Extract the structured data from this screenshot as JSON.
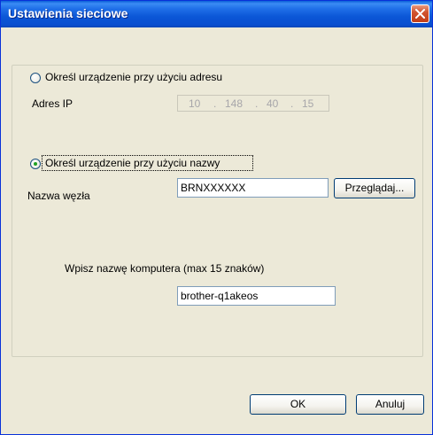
{
  "window": {
    "title": "Ustawienia sieciowe"
  },
  "by_address": {
    "radio_label": "Określ urządzenie przy użyciu adresu",
    "ip_label": "Adres IP",
    "ip": [
      "10",
      "148",
      "40",
      "15"
    ],
    "selected": false
  },
  "by_name": {
    "radio_label": "Określ urządzenie przy użyciu nazwy",
    "node_label": "Nazwa węzła",
    "node_value": "BRNXXXXXX",
    "browse_button": "Przeglądaj...",
    "selected": true
  },
  "computer": {
    "label": "Wpisz nazwę komputera (max 15 znaków)",
    "value": "brother-q1akeos"
  },
  "buttons": {
    "ok": "OK",
    "cancel": "Anuluj"
  },
  "icons": {
    "close": "close-icon"
  }
}
